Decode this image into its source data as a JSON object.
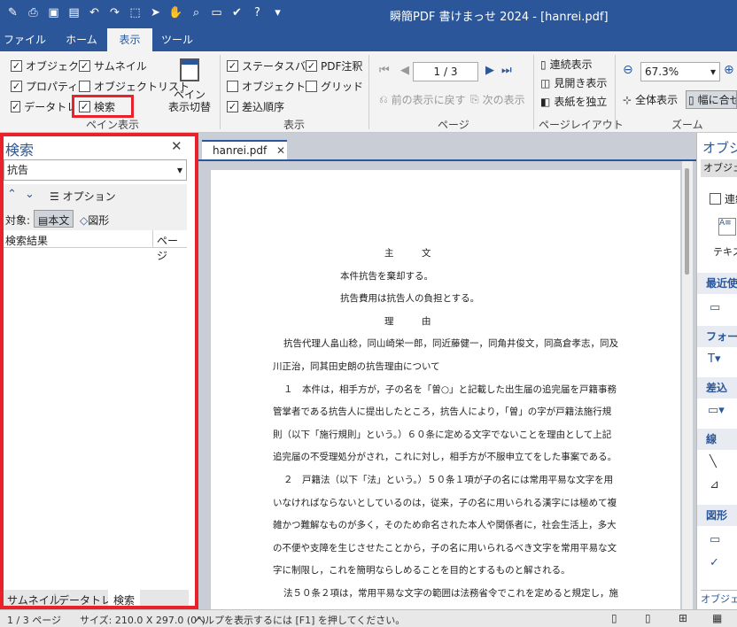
{
  "app": {
    "title": "瞬簡PDF 書けまっせ 2024 - [hanrei.pdf]"
  },
  "tabs": [
    "ファイル",
    "ホーム",
    "表示",
    "ツール"
  ],
  "ribbon": {
    "pane": {
      "items": [
        "オブジェクト",
        "サムネイル",
        "プロパティ",
        "オブジェクトリスト",
        "データトレー",
        "検索"
      ],
      "toggle_label": "ペイン\n表示切替",
      "group_label": "ペイン表示"
    },
    "display": {
      "items": [
        "ステータスバー",
        "PDF注釈",
        "オブジェクト名",
        "グリッド",
        "差込順序"
      ],
      "group_label": "表示"
    },
    "page": {
      "current": "1 / 3",
      "prev_view": "前の表示に戻す",
      "next_view": "次の表示",
      "group_label": "ページ"
    },
    "layout": {
      "items": [
        "連続表示",
        "見開き表示",
        "表紙を独立"
      ],
      "group_label": "ページレイアウト"
    },
    "zoom": {
      "value": "67.3%",
      "fit_all": "全体表示",
      "fit_width": "幅に合せ",
      "group_label": "ズーム"
    }
  },
  "left_pane": {
    "title": "検索",
    "search_value": "抗告",
    "options_label": "オプション",
    "target_label": "対象:",
    "target_text": "本文",
    "target_shape": "図形",
    "col_results": "検索結果",
    "col_page": "ページ",
    "bottom_tabs": [
      "サムネイル",
      "データトレー",
      "検索"
    ]
  },
  "document": {
    "tab_label": "hanrei.pdf",
    "lines": [
      "主　　　文",
      "本件抗告を棄却する。",
      "抗告費用は抗告人の負担とする。",
      "理　　　由",
      "抗告代理人畠山稔，同山崎栄一郎，同近藤健一，同角井俊文，同高倉孝志，同及",
      "川正治，同其田史朗の抗告理由について",
      "１　本件は，相手方が，子の名を「曽○」と記載した出生届の追完届を戸籍事務",
      "管掌者である抗告人に提出したところ，抗告人により，「曽」の字が戸籍法施行規",
      "則（以下「施行規則」という。）６０条に定める文字でないことを理由として上記",
      "追完届の不受理処分がされ，これに対し，相手方が不服申立てをした事案である。",
      "２　戸籍法（以下「法」という。）５０条１項が子の名には常用平易な文字を用",
      "いなければならないとしているのは，従来，子の名に用いられる漢字には極めて複",
      "雑かつ難解なものが多く，そのため命名された本人や関係者に，社会生活上，多大",
      "の不便や支障を生じさせたことから，子の名に用いられるべき文字を常用平易な文",
      "字に制限し，これを簡明ならしめることを目的とするものと解される。",
      "法５０条２項は，常用平易な文字の範囲は法務省令でこれを定めると規定し，施"
    ]
  },
  "right_pane": {
    "title": "オブジ",
    "sub_tab": "オブジェク",
    "checkbox_label": "連続",
    "text_label": "テキス",
    "sections": [
      "最近使",
      "フォーム",
      "差込",
      "線",
      "図形"
    ],
    "bottom_tab": "オブジェク"
  },
  "status": {
    "page": "1 / 3 ページ",
    "size": "サイズ: 210.0 X 297.0 (0°)",
    "help": "ヘルプを表示するには [F1] を押してください。"
  },
  "colors": {
    "accent": "#2b579a",
    "highlight": "#e8212b"
  }
}
